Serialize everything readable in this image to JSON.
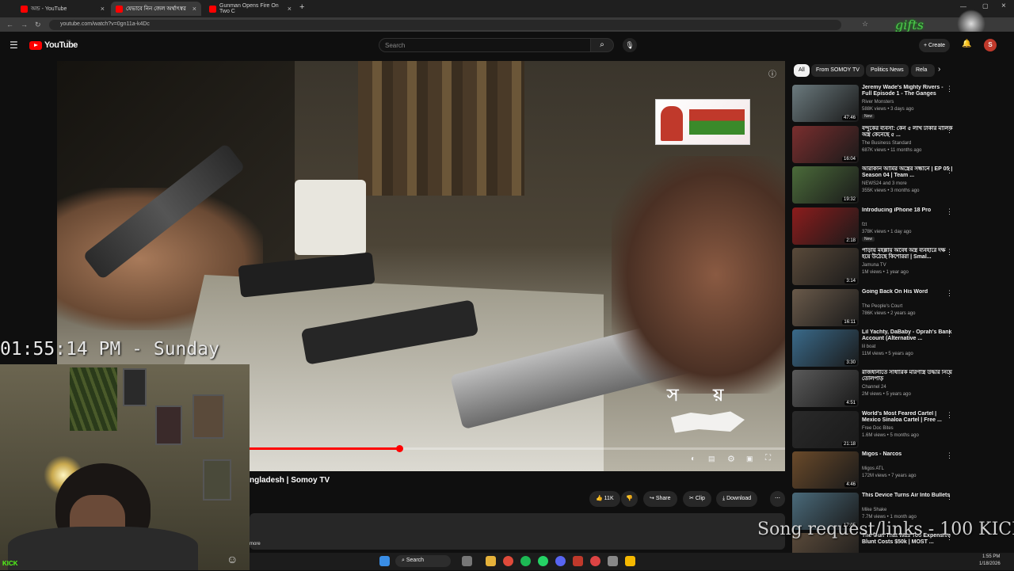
{
  "browser": {
    "tabs": [
      {
        "label": "অন্ড - YouTube"
      },
      {
        "label": "যেভাবে নিন জেল অর্থাৎস্বর"
      },
      {
        "label": "Gunman Opens Fire On Two C"
      }
    ],
    "url": "youtube.com/watch?v=0gn11a-k4Dc"
  },
  "header": {
    "logo_text": "YouTube",
    "logo_sup": "BD",
    "search_placeholder": "Search",
    "create_label": "Create",
    "avatar_letter": "S"
  },
  "video": {
    "title": "ngladesh | Somoy TV",
    "progress": 0.47,
    "channel_logo": "স য়"
  },
  "actions": {
    "like_count": "11K",
    "share": "Share",
    "clip": "Clip",
    "download": "Download"
  },
  "description_more": "more",
  "overlay": {
    "clock": "01:55:14 PM - Sunday",
    "song_line": "Song request/links - 100 KICKs",
    "kick_badge": "KICK",
    "watermark": "gifts"
  },
  "chips": [
    "All",
    "From SOMOY TV",
    "Politics News",
    "Rela"
  ],
  "recommendations": [
    {
      "title": "Jeremy Wade's Mighty Rivers - Full Episode 1 - The Ganges",
      "channel": "River Monsters",
      "meta": "588K views • 3 days ago",
      "badge": "New",
      "duration": "47:46",
      "thumb_color": "#6b7a7e"
    },
    {
      "title": "বন্দুকের ব্যবসা: কেন ৫ লাখ টাকার মালিক অস্ত্র কেনেছে ৫ ...",
      "channel": "The Business Standard",
      "meta": "687K views • 11 months ago",
      "badge": "",
      "duration": "16:04",
      "thumb_color": "#7a2e2e"
    },
    {
      "title": "আরাকান আর্মির অস্ত্রের সন্ধানে | EP 05 | Season 04 | Team ...",
      "channel": "NEWS24 and 3 more",
      "meta": "355K views • 3 months ago",
      "badge": "",
      "duration": "19:32",
      "thumb_color": "#4b6b3a"
    },
    {
      "title": "Introducing iPhone 18 Pro",
      "channel": "fzt",
      "meta": "378K views • 1 day ago",
      "badge": "New",
      "duration": "2:18",
      "thumb_color": "#8c1c1c"
    },
    {
      "title": "পাড়ায় মহল্লায় অবৈধ অস্ত্র ব্যবহারে দক্ষ হয়ে উঠেছে কিশোররা | Smal...",
      "channel": "Jamuna TV",
      "meta": "1M views • 1 year ago",
      "badge": "",
      "duration": "3:14",
      "thumb_color": "#5a4a3a"
    },
    {
      "title": "Going Back On His Word",
      "channel": "The People's Court",
      "meta": "786K views • 2 years ago",
      "badge": "",
      "duration": "16:11",
      "thumb_color": "#6a5a4a"
    },
    {
      "title": "Lil Yachty, DaBaby - Oprah's Bank Account (Alternative ...",
      "channel": "lil boat",
      "meta": "11M views • 5 years ago",
      "badge": "",
      "duration": "3:30",
      "thumb_color": "#3a6a8a"
    },
    {
      "title": "রাজধানীতে সাধারিক মারণাস্ত্র উদ্ধার নিয়ে তোলপাড়",
      "channel": "Channel 24",
      "meta": "2M views • 5 years ago",
      "badge": "",
      "duration": "4:51",
      "thumb_color": "#5a5a5a"
    },
    {
      "title": "World's Most Feared Cartel | Mexico Sinaloa Cartel | Free ...",
      "channel": "Free Doc Bites",
      "meta": "1.6M views • 5 months ago",
      "badge": "",
      "duration": "21:18",
      "thumb_color": "#2a2a2a"
    },
    {
      "title": "Migos - Narcos",
      "channel": "Migos ATL",
      "meta": "172M views • 7 years ago",
      "badge": "",
      "duration": "4:46",
      "thumb_color": "#6a4a2a"
    },
    {
      "title": "This Device Turns Air Into Bullets",
      "channel": "Mike Shake",
      "meta": "7.7M views • 1 month ago",
      "badge": "",
      "duration": "17:05",
      "thumb_color": "#4a6a7a"
    },
    {
      "title": "The Gun That Was Too Expensive Blunt Costs $50k | MOST ...",
      "channel": "",
      "meta": "",
      "badge": "",
      "duration": "",
      "thumb_color": "#5a4a3a"
    }
  ],
  "taskbar": {
    "search_label": "Search",
    "time": "1:55 PM",
    "date": "1/18/2026"
  },
  "colors": {
    "accent": "#ff0000",
    "background": "#0f0f0f"
  }
}
